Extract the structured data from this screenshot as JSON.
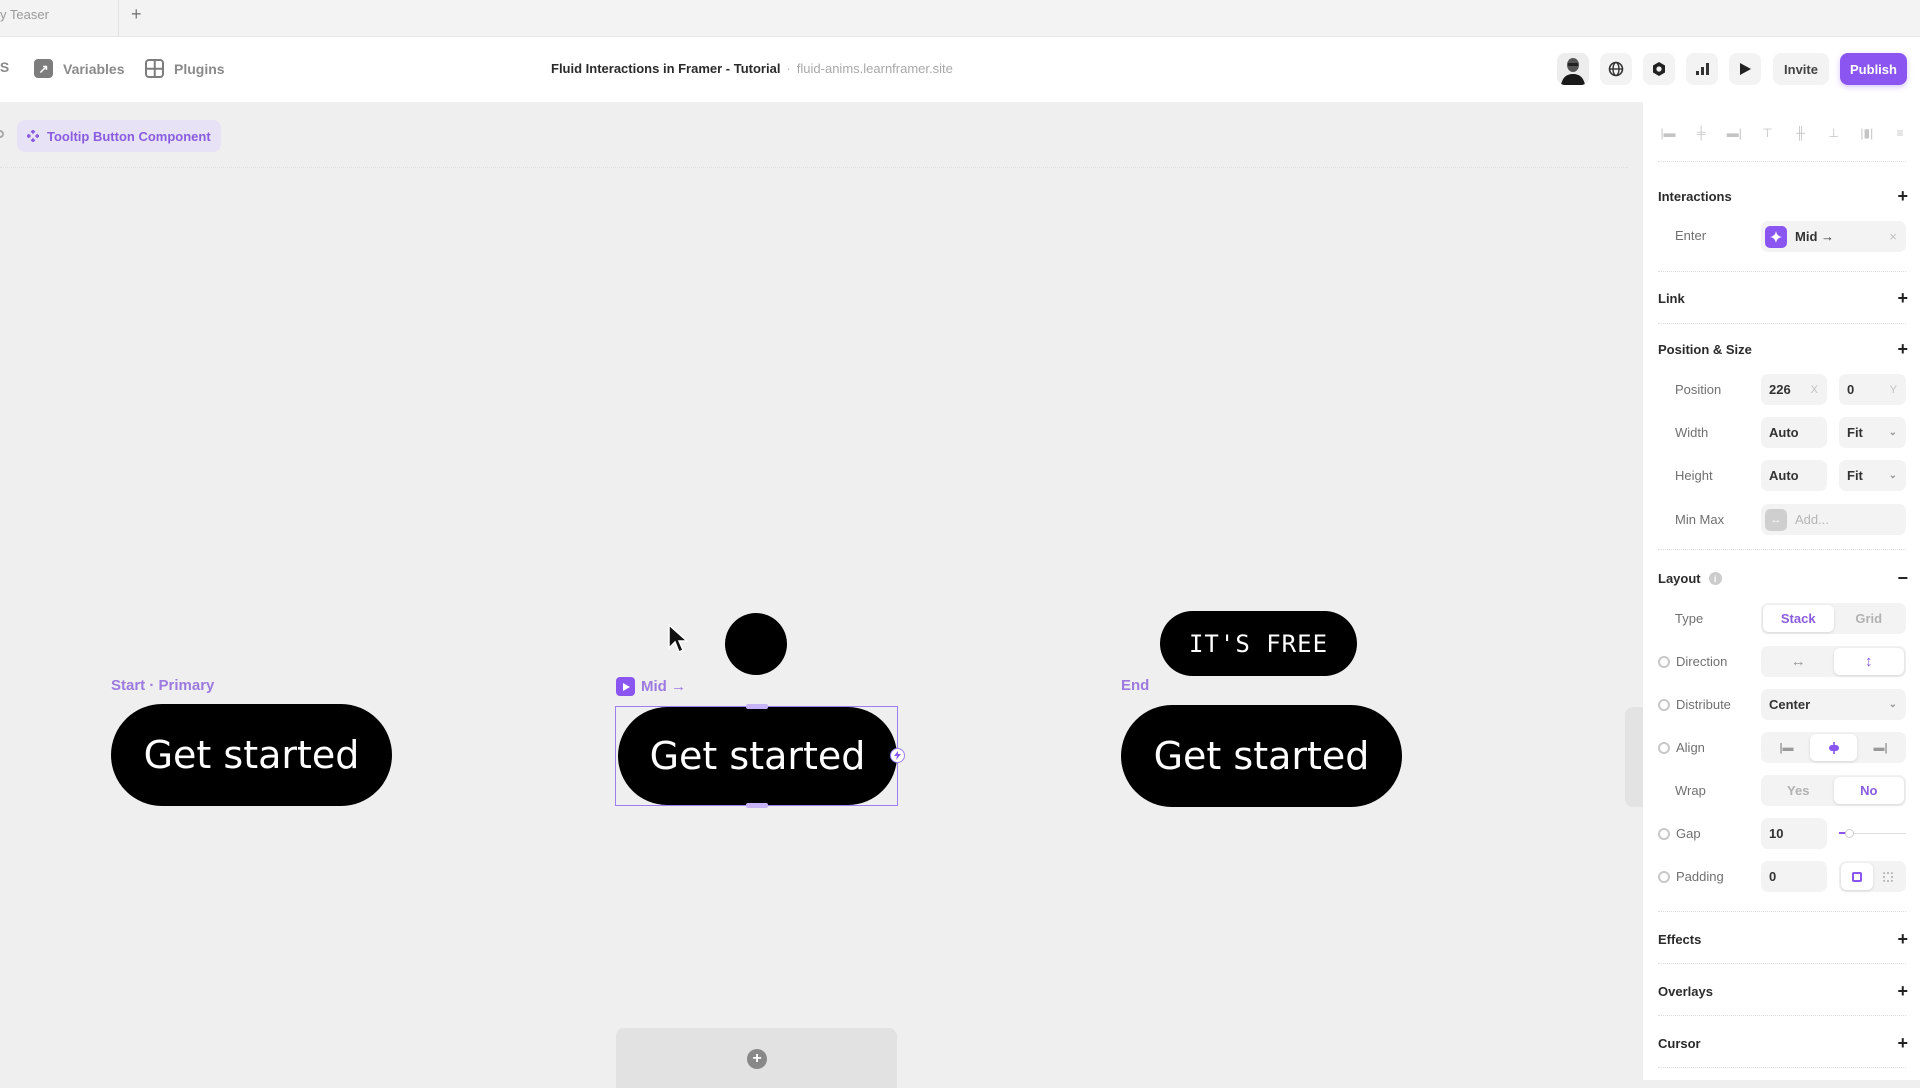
{
  "tabs": {
    "active_label": "y Teaser",
    "add_label": "+"
  },
  "toolbar": {
    "left_partial_label": "IS",
    "variables_label": "Variables",
    "plugins_label": "Plugins",
    "doc_title": "Fluid Interactions in Framer - Tutorial",
    "separator": "·",
    "doc_url": "fluid-anims.learnframer.site",
    "icons": [
      "avatar",
      "globe-icon",
      "settings-icon",
      "analytics-icon",
      "play-icon"
    ],
    "invite_label": "Invite",
    "publish_label": "Publish",
    "accent_color": "#8a55f0"
  },
  "breadcrumb": {
    "component_label": "Tooltip Button Component"
  },
  "canvas": {
    "variants": [
      {
        "label": "Start · Primary",
        "button_text": "Get started"
      },
      {
        "label": "Mid →",
        "button_text": "Get started"
      },
      {
        "label": "End",
        "button_text": "Get started",
        "tooltip_text": "IT'S FREE"
      }
    ],
    "add_variant_label": "+"
  },
  "panel": {
    "interactions": {
      "title": "Interactions",
      "trigger_label": "Enter",
      "target_label": "Mid →",
      "remove_label": "×"
    },
    "link": {
      "title": "Link"
    },
    "position_size": {
      "title": "Position & Size",
      "position_label": "Position",
      "x_value": "226",
      "x_suffix": "X",
      "y_value": "0",
      "y_suffix": "Y",
      "width_label": "Width",
      "width_value": "Auto",
      "width_mode": "Fit",
      "height_label": "Height",
      "height_value": "Auto",
      "height_mode": "Fit",
      "minmax_label": "Min Max",
      "minmax_placeholder": "Add..."
    },
    "layout": {
      "title": "Layout",
      "collapse_label": "−",
      "type_label": "Type",
      "type_options": [
        "Stack",
        "Grid"
      ],
      "type_selected": "Stack",
      "direction_label": "Direction",
      "direction_options": [
        "↔",
        "↕"
      ],
      "direction_selected": "vertical",
      "distribute_label": "Distribute",
      "distribute_value": "Center",
      "align_label": "Align",
      "align_selected": "center",
      "wrap_label": "Wrap",
      "wrap_options": [
        "Yes",
        "No"
      ],
      "wrap_selected": "No",
      "gap_label": "Gap",
      "gap_value": "10",
      "padding_label": "Padding",
      "padding_value": "0"
    },
    "effects": {
      "title": "Effects"
    },
    "overlays": {
      "title": "Overlays"
    },
    "cursor": {
      "title": "Cursor"
    },
    "plus_label": "+"
  }
}
